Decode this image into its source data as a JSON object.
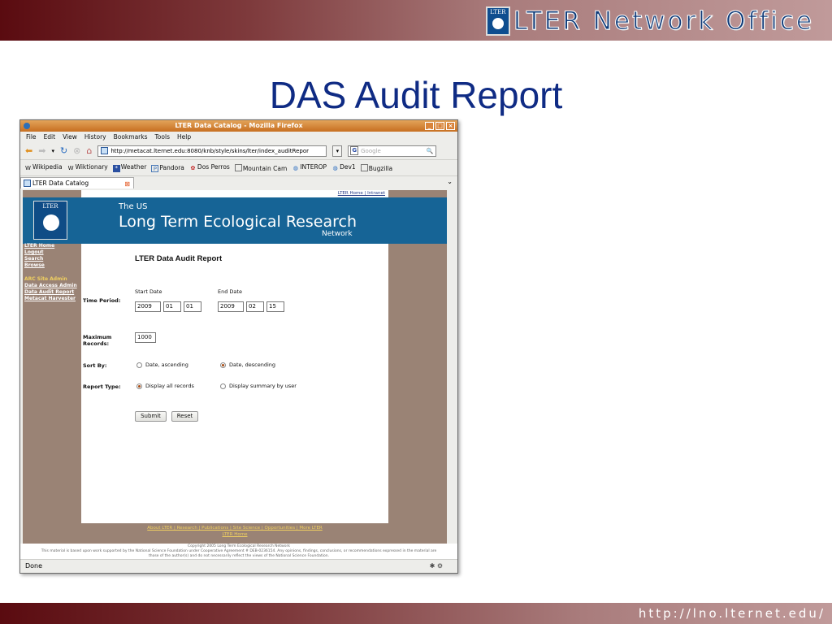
{
  "slide": {
    "brand": "LTER Network Office",
    "brand_logo": "LTER",
    "title": "DAS Audit Report",
    "url": "http://lno.lternet.edu/"
  },
  "browser": {
    "window_title": "LTER Data Catalog - Mozilla Firefox",
    "menus": [
      "File",
      "Edit",
      "View",
      "History",
      "Bookmarks",
      "Tools",
      "Help"
    ],
    "address": "http://metacat.lternet.edu:8080/knb/style/skins/lter/index_auditRepor",
    "search_placeholder": "Google",
    "bookmarks": [
      "Wikipedia",
      "Wiktionary",
      "Weather",
      "Pandora",
      "Dos Perros",
      "Mountain Cam",
      "INTEROP",
      "Dev1",
      "Bugzilla"
    ],
    "tab_label": "LTER Data Catalog",
    "status": "Done"
  },
  "page": {
    "top_links": "LTER Home | Intranet",
    "logo_text": "LTER",
    "banner_line1": "The US",
    "banner_line2": "Long Term Ecological Research",
    "banner_line3": "Network",
    "nav": [
      "LTER Home",
      "Logout",
      "Search",
      "Browse"
    ],
    "admin_heading": "ARC Site Admin",
    "admin_links": [
      "Data Access Admin",
      "Data Audit Report",
      "Metacat Harvester"
    ],
    "form_title": "LTER Data Audit Report",
    "time_period_label": "Time Period:",
    "start_date_label": "Start Date",
    "end_date_label": "End Date",
    "start_date": [
      "2009",
      "01",
      "01"
    ],
    "end_date": [
      "2009",
      "02",
      "15"
    ],
    "max_records_label": "Maximum Records:",
    "max_records": "1000",
    "sort_by_label": "Sort By:",
    "sort_options": [
      "Date, ascending",
      "Date, descending"
    ],
    "sort_selected": "Date, descending",
    "report_type_label": "Report Type:",
    "report_options": [
      "Display all records",
      "Display summary by user"
    ],
    "report_selected": "Display all records",
    "submit_label": "Submit",
    "reset_label": "Reset",
    "footer_links": "About LTER | Research | Publications | Site Science | Opportunities | More LTER",
    "footer_home": "LTER Home",
    "copyright": "Copyright 2005 Long Term Ecological Research Network",
    "disclaimer": "This material is based upon work supported by the National Science Foundation under Cooperative Agreement # DEB-0236154. Any opinions, findings, conclusions, or recommendations expressed in the material are",
    "disclaimer2": "those of the author(s) and do not necessarily reflect the views of the National Science Foundation."
  }
}
